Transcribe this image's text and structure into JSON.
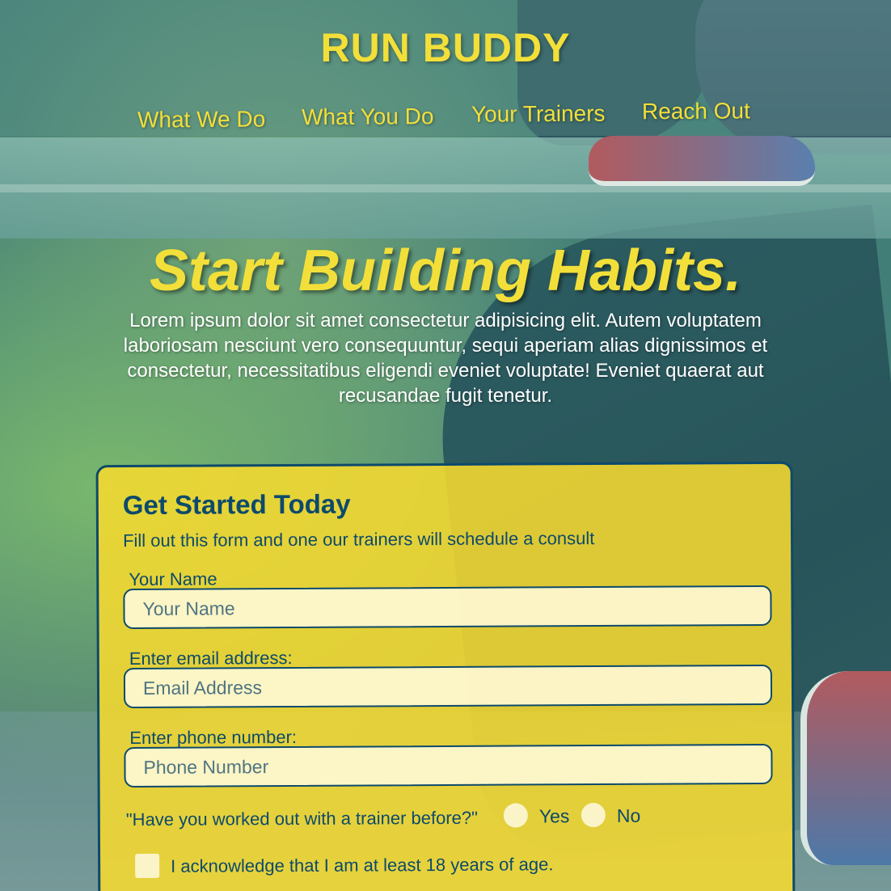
{
  "header": {
    "brand": "RUN BUDDY",
    "nav": [
      "What We Do",
      "What You Do",
      "Your Trainers",
      "Reach Out"
    ]
  },
  "hero": {
    "title": "Start Building Habits.",
    "text": "Lorem ipsum dolor sit amet consectetur adipisicing elit. Autem voluptatem laboriosam nesciunt vero consequuntur, sequi aperiam alias dignissimos et consectetur, necessitatibus eligendi eveniet voluptate! Eveniet quaerat aut recusandae fugit tenetur."
  },
  "form": {
    "title": "Get Started Today",
    "subtitle": "Fill out this form and one our trainers will schedule a consult",
    "name_label": "Your Name",
    "name_placeholder": "Your Name",
    "email_label": "Enter email address:",
    "email_placeholder": "Email Address",
    "phone_label": "Enter phone number:",
    "phone_placeholder": "Phone Number",
    "question": "\"Have you worked out with a trainer before?\"",
    "option_yes": "Yes",
    "option_no": "No",
    "acknowledge": "I acknowledge that I am at least 18 years of age."
  },
  "colors": {
    "accent": "#f2df3a",
    "text_dark": "#0d4a6b",
    "card": "#f6da30"
  }
}
